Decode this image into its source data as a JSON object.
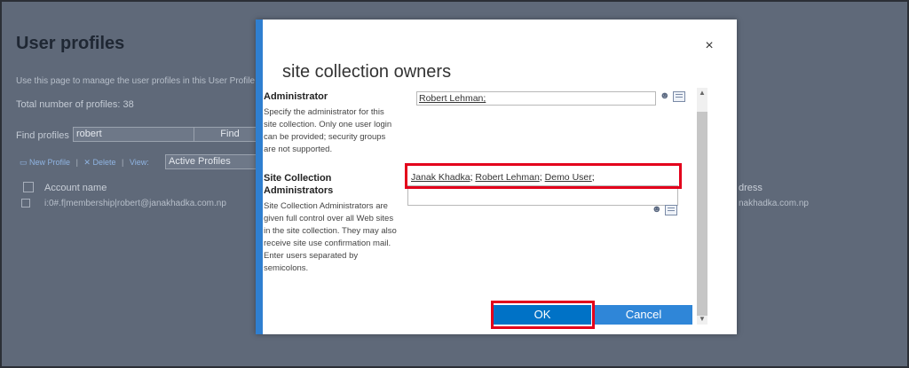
{
  "background": {
    "title": "User profiles",
    "description": "Use this page to manage the user profiles in this User Profile",
    "total": "Total number of profiles: 38",
    "find_label": "Find profiles",
    "find_value": "robert",
    "find_button": "Find",
    "toolbar": {
      "new_profile": "New Profile",
      "delete": "Delete",
      "view_label": "View:"
    },
    "view_value": "Active Profiles",
    "columns": {
      "account": "Account name",
      "address": "dress"
    },
    "row": {
      "account": "i:0#.f|membership|robert@janakhadka.com.np",
      "address": "nakhadka.com.np"
    }
  },
  "dialog": {
    "title": "site collection owners",
    "close_glyph": "×",
    "administrator": {
      "label": "Administrator",
      "description": "Specify the administrator for this site collection. Only one user login can be provided; security groups are not supported.",
      "value": "Robert Lehman;"
    },
    "site_admins": {
      "label": "Site Collection Administrators",
      "description": "Site Collection Administrators are given full control over all Web sites in the site collection. They may also receive site use confirmation mail. Enter users separated by semicolons.",
      "users": [
        "Janak Khadka",
        "Robert Lehman",
        "Demo User"
      ]
    },
    "ok_label": "OK",
    "cancel_label": "Cancel"
  },
  "colors": {
    "highlight": "#e3001b",
    "accent": "#2f7fd0",
    "ok": "#0072c6",
    "cancel": "#2f86d8"
  }
}
